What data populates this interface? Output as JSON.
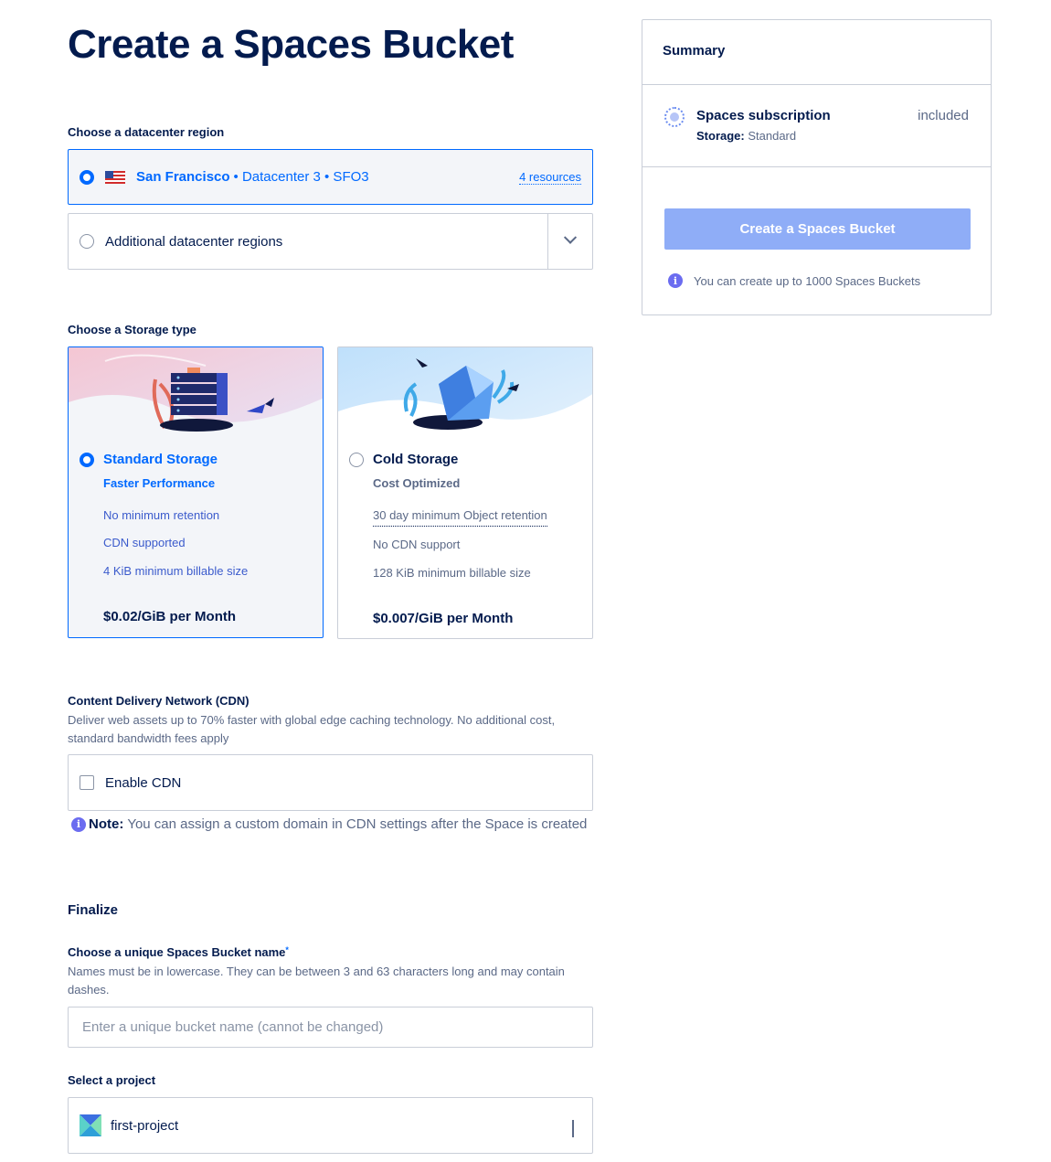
{
  "page": {
    "title": "Create a Spaces Bucket"
  },
  "region": {
    "label": "Choose a datacenter region",
    "selected_name": "San Francisco",
    "selected_meta": "• Datacenter 3 • SFO3",
    "resources_link": "4 resources",
    "additional_label": "Additional datacenter regions"
  },
  "storage": {
    "label": "Choose a Storage type",
    "options": [
      {
        "title": "Standard Storage",
        "subtitle": "Faster Performance",
        "features": [
          "No minimum retention",
          "CDN supported",
          "4 KiB minimum billable size"
        ],
        "price": "$0.02/GiB per Month",
        "selected": true
      },
      {
        "title": "Cold Storage",
        "subtitle": "Cost Optimized",
        "features": [
          "30 day minimum Object retention",
          "No CDN support",
          "128 KiB minimum billable size"
        ],
        "price": "$0.007/GiB per Month",
        "selected": false
      }
    ]
  },
  "cdn": {
    "heading": "Content Delivery Network (CDN)",
    "description": "Deliver web assets up to 70% faster with global edge caching technology. No additional cost, standard bandwidth fees apply",
    "checkbox_label": "Enable CDN",
    "note_prefix": "Note:",
    "note_text": "You can assign a custom domain in CDN settings after the Space is created"
  },
  "finalize": {
    "heading": "Finalize",
    "name_label": "Choose a unique Spaces Bucket name",
    "required_mark": "*",
    "name_help": "Names must be in lowercase. They can be between 3 and 63 characters long and may contain dashes.",
    "name_placeholder": "Enter a unique bucket name (cannot be changed)",
    "project_label": "Select a project",
    "project_value": "first-project"
  },
  "summary": {
    "heading": "Summary",
    "item_title": "Spaces subscription",
    "item_detail_label": "Storage:",
    "item_detail_value": "Standard",
    "item_price": "included",
    "button_label": "Create a Spaces Bucket",
    "limit_text": "You can create up to 1000 Spaces Buckets"
  },
  "colors": {
    "accent": "#0069ff",
    "text": "#031b4e",
    "muted": "#5b6987",
    "button_disabled": "#8fadf7"
  }
}
